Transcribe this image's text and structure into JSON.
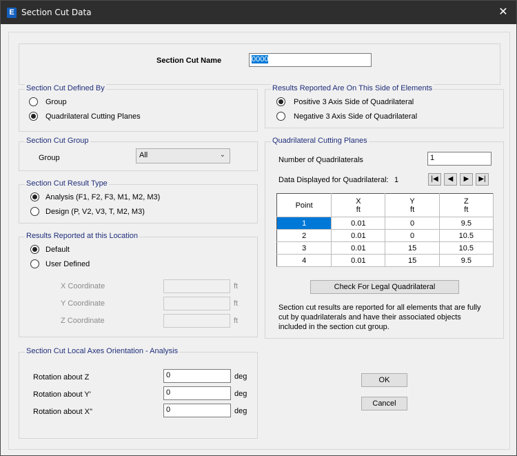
{
  "window": {
    "title": "Section Cut Data",
    "app_icon_letter": "E"
  },
  "name_section": {
    "label": "Section Cut Name",
    "value": "0000"
  },
  "defined_by": {
    "legend": "Section Cut Defined By",
    "options": [
      "Group",
      "Quadrilateral Cutting Planes"
    ],
    "selected": "Quadrilateral Cutting Planes"
  },
  "side": {
    "legend": "Results Reported Are On This Side of Elements",
    "options": [
      "Positive 3 Axis Side of Quadrilateral",
      "Negative 3 Axis Side of Quadrilateral"
    ],
    "selected": "Positive 3 Axis Side of Quadrilateral"
  },
  "group": {
    "legend": "Section Cut Group",
    "label": "Group",
    "value": "All"
  },
  "result_type": {
    "legend": "Section Cut Result Type",
    "options": [
      "Analysis  (F1, F2, F3, M1, M2, M3)",
      "Design  (P, V2, V3, T, M2, M3)"
    ],
    "selected": "Analysis  (F1, F2, F3, M1, M2, M3)"
  },
  "location": {
    "legend": "Results Reported at this Location",
    "options": [
      "Default",
      "User Defined"
    ],
    "selected": "Default",
    "x_label": "X  Coordinate",
    "y_label": "Y  Coordinate",
    "z_label": "Z  Coordinate",
    "unit": "ft"
  },
  "local_axes": {
    "legend": "Section Cut Local Axes Orientation - Analysis",
    "rows": [
      {
        "label": "Rotation about  Z",
        "value": "0",
        "unit": "deg"
      },
      {
        "label": "Rotation about  Y'",
        "value": "0",
        "unit": "deg"
      },
      {
        "label": "Rotation about  X''",
        "value": "0",
        "unit": "deg"
      }
    ]
  },
  "quad": {
    "legend": "Quadrilateral Cutting Planes",
    "num_label": "Number of Quadrilaterals",
    "num_value": "1",
    "displayed_label": "Data Displayed for Quadrilateral:",
    "displayed_value": "1",
    "table": {
      "headers": [
        {
          "name": "Point",
          "unit": ""
        },
        {
          "name": "X",
          "unit": "ft"
        },
        {
          "name": "Y",
          "unit": "ft"
        },
        {
          "name": "Z",
          "unit": "ft"
        }
      ],
      "rows": [
        [
          "1",
          "0.01",
          "0",
          "9.5"
        ],
        [
          "2",
          "0.01",
          "0",
          "10.5"
        ],
        [
          "3",
          "0.01",
          "15",
          "10.5"
        ],
        [
          "4",
          "0.01",
          "15",
          "9.5"
        ]
      ],
      "selected_row": 0
    },
    "check_button": "Check For Legal Quadrilateral",
    "note": "Section cut results are reported for all elements that are fully cut by quadrilaterals and have their associated objects included in the section cut group."
  },
  "buttons": {
    "ok": "OK",
    "cancel": "Cancel"
  },
  "icons": {
    "close": "close-icon",
    "chevron": "chevron-down-icon",
    "nav": [
      "first-record-icon",
      "previous-record-icon",
      "next-record-icon",
      "last-record-icon"
    ]
  }
}
